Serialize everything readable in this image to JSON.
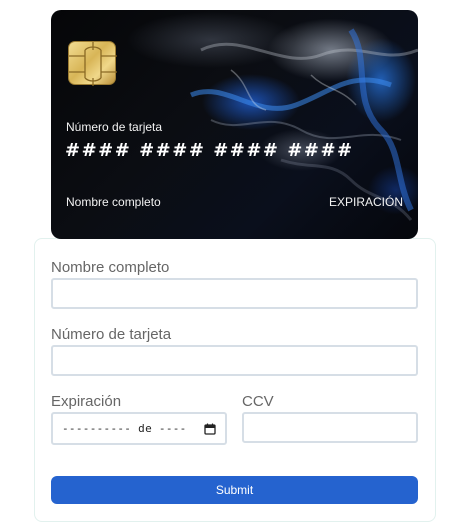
{
  "card": {
    "number_label": "Número de tarjeta",
    "number_value": "#### #### #### ####",
    "holder": "Nombre completo",
    "expiration": "EXPIRACIÓN"
  },
  "form": {
    "name_label": "Nombre completo",
    "name_value": "",
    "number_label": "Número de tarjeta",
    "number_value": "",
    "expiration_label": "Expiración",
    "expiration_value": "---------- de ----",
    "ccv_label": "CCV",
    "ccv_value": "",
    "submit_label": "Submit"
  },
  "icons": {
    "card_chip": "chip-icon",
    "date_picker": "calendar-icon"
  },
  "colors": {
    "accent": "#2563cf",
    "chip_gold": "#d8b557",
    "card_background": "#0b0d12"
  }
}
